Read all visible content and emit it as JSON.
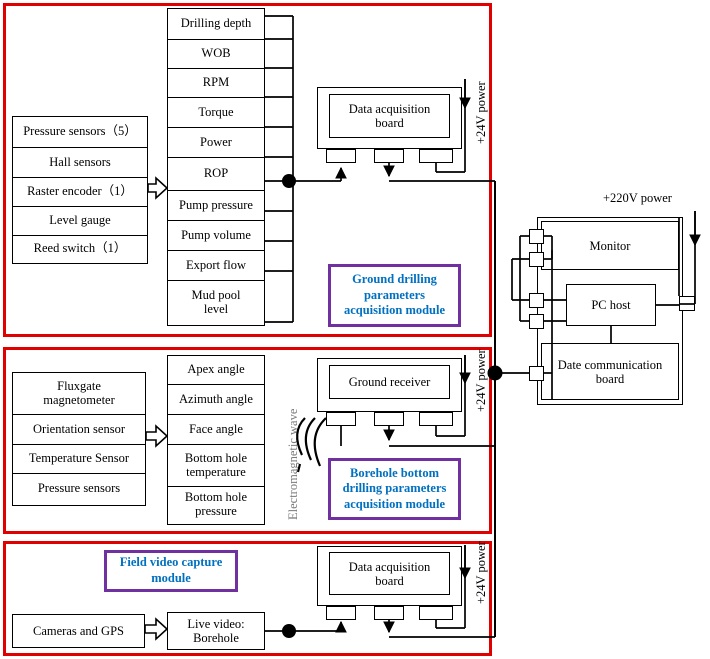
{
  "diagram": {
    "title": "Drilling parameters acquisition system block diagram",
    "colors": {
      "module_frame": "#e00000",
      "callout_border": "#7030a0",
      "callout_text": "#0070c0",
      "wave_label": "#7a7a7a",
      "wire": "#000000"
    }
  },
  "modules": [
    {
      "id": "ground-drilling",
      "callout": "Ground drilling\nparameters\nacquisition module",
      "callout_lines": [
        "Ground drilling",
        "parameters",
        "acquisition module"
      ],
      "power_label": "+24V power",
      "sensors": {
        "items": [
          "Pressure sensors（5）",
          "Hall sensors",
          "Raster encoder（1）",
          "Level gauge",
          "Reed switch（1）"
        ]
      },
      "parameters": {
        "items": [
          "Drilling depth",
          "WOB",
          "RPM",
          "Torque",
          "Power",
          "ROP",
          "Pump pressure",
          "Pump volume",
          "Export flow",
          "Mud pool\nlevel"
        ]
      },
      "board": {
        "lines": [
          "Data acquisition",
          "board"
        ]
      }
    },
    {
      "id": "borehole-bottom",
      "callout_lines": [
        "Borehole bottom",
        "drilling parameters",
        "acquisition module"
      ],
      "power_label": "+24V power",
      "channel_label": "Electromagnetic wave",
      "sensors": {
        "items": [
          "Fluxgate\nmagnetometer",
          "Orientation sensor",
          "Temperature Sensor",
          "Pressure sensors"
        ]
      },
      "parameters": {
        "items": [
          "Apex angle",
          "Azimuth angle",
          "Face angle",
          "Bottom hole\ntemperature",
          "Bottom hole\npressure"
        ]
      },
      "board": {
        "lines": [
          "Ground receiver"
        ]
      }
    },
    {
      "id": "field-video",
      "callout_lines": [
        "Field video capture",
        "module"
      ],
      "power_label": "+24V power",
      "source": {
        "label": "Cameras and GPS"
      },
      "stream": {
        "lines": [
          "Live video:",
          "Borehole"
        ]
      },
      "board": {
        "lines": [
          "Data acquisition",
          "board"
        ]
      }
    }
  ],
  "host_panel": {
    "power_label": "+220V power",
    "monitor": "Monitor",
    "pc_host": "PC host",
    "comm_board_lines": [
      "Date communication",
      "board"
    ]
  }
}
